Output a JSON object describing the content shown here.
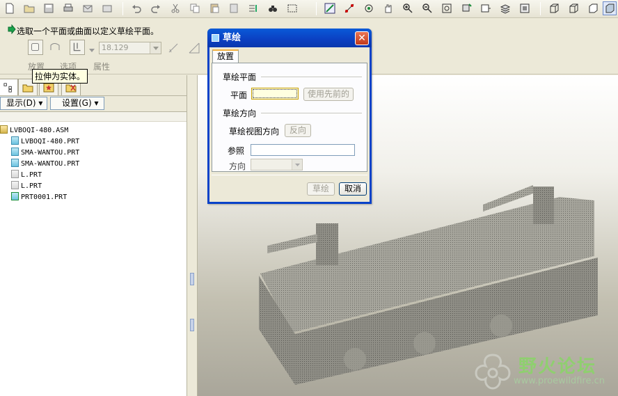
{
  "dashboard": {
    "prompt": "选取一个平面或曲面以定义草绘平面。",
    "depth_value": "18.129",
    "tabs": [
      "放置",
      "选项",
      "属性"
    ],
    "tooltip": "拉伸为实体。"
  },
  "navigator": {
    "show_menu": "显示(D) ▾",
    "settings_menu": "设置(G) ▾",
    "tree": [
      {
        "label": "LVBOQI-480.ASM",
        "icon": "assembly-icon"
      },
      {
        "label": "LVBOQI-480.PRT",
        "icon": "part-icon"
      },
      {
        "label": "SMA-WANTOU.PRT",
        "icon": "part-icon"
      },
      {
        "label": "SMA-WANTOU.PRT",
        "icon": "part-icon"
      },
      {
        "label": "L.PRT",
        "icon": "part-gray-icon"
      },
      {
        "label": "L.PRT",
        "icon": "part-gray-icon"
      },
      {
        "label": "PRT0001.PRT",
        "icon": "part-active-icon"
      }
    ]
  },
  "dialog": {
    "title": "草绘",
    "close": "✕",
    "tab": "放置",
    "group_plane": "草绘平面",
    "plane_label": "平面",
    "use_prev_button": "使用先前的",
    "group_orient": "草绘方向",
    "view_dir_label": "草绘视图方向",
    "flip_button": "反向",
    "reference_label": "参照",
    "orientation_label": "方向",
    "sketch_button": "草绘",
    "cancel_button": "取消"
  },
  "watermark": {
    "text": "野火论坛",
    "url": "www.proewildfire.cn"
  },
  "colors": {
    "title_bar": "#0b3fc1",
    "dialog_bg": "#ece9d8",
    "watermark_green": "#8fcf6f"
  }
}
